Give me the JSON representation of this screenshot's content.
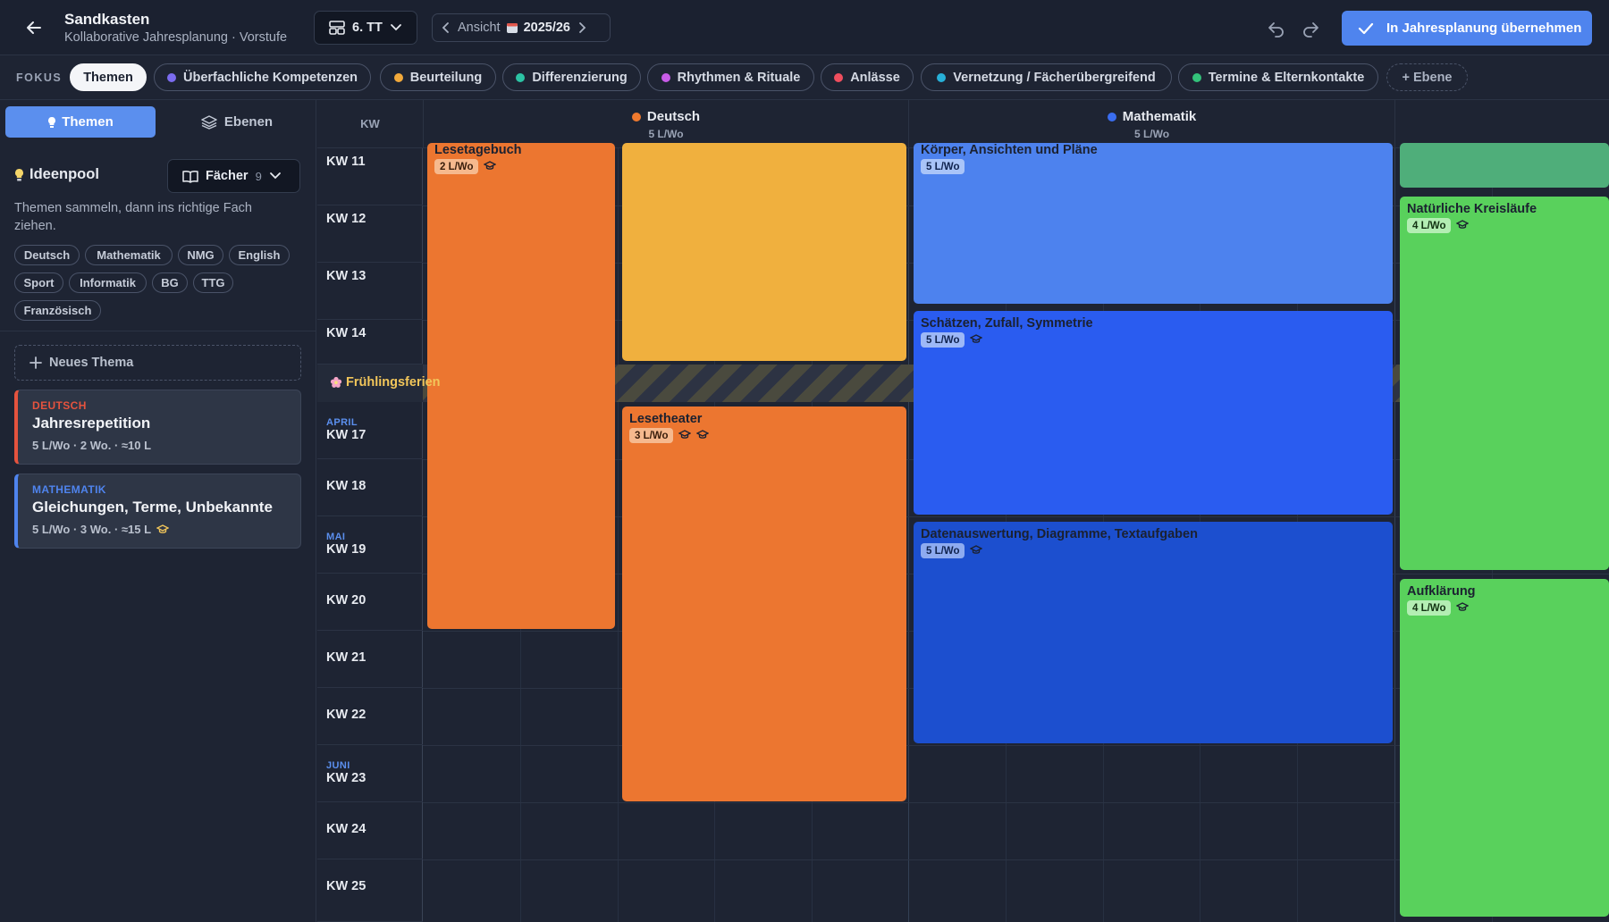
{
  "header": {
    "title": "Sandkasten",
    "subtitle": "Kollaborative Jahresplanung · Vorstufe",
    "class_select": "6. TT",
    "view_label": "Ansicht",
    "view_year": "2025/26",
    "apply_label": "In Jahresplanung übernehmen"
  },
  "focus": {
    "label": "FOKUS",
    "chips": [
      {
        "label": "Themen",
        "color": ""
      },
      {
        "label": "Überfachliche Kompetenzen",
        "color": "#7b6cf0"
      },
      {
        "label": "Beurteilung",
        "color": "#f2a93b"
      },
      {
        "label": "Differenzierung",
        "color": "#2cc3a4"
      },
      {
        "label": "Rhythmen & Rituale",
        "color": "#c85ce8"
      },
      {
        "label": "Anlässe",
        "color": "#ef4e5e"
      },
      {
        "label": "Vernetzung / Fächerübergreifend",
        "color": "#27b0d8"
      },
      {
        "label": "Termine & Elternkontakte",
        "color": "#33c27a"
      },
      {
        "label": "+ Ebene",
        "color": ""
      }
    ]
  },
  "sidebar": {
    "tab_themen": "Themen",
    "tab_ebenen": "Ebenen",
    "pool_title": "Ideenpool",
    "faecher_label": "Fächer",
    "faecher_count": "9",
    "description": "Themen sammeln, dann ins richtige Fach ziehen.",
    "tags": [
      "Deutsch",
      "Mathematik",
      "NMG",
      "English",
      "Sport",
      "Informatik",
      "BG",
      "TTG",
      "Französisch"
    ],
    "new_theme": "Neues Thema",
    "cards": [
      {
        "subject": "DEUTSCH",
        "title": "Jahresrepetition",
        "meta": "5 L/Wo · 2 Wo. · ≈10 L",
        "accent": "#e5533e"
      },
      {
        "subject": "MATHEMATIK",
        "title": "Gleichungen, Terme, Unbekannte",
        "meta": "5 L/Wo · 3 Wo. · ≈15 L",
        "accent": "#4f84ee"
      }
    ]
  },
  "grid": {
    "kw_header": "KW",
    "subjects": [
      {
        "name": "Deutsch",
        "lw": "5 L/Wo",
        "color": "#f07a2e"
      },
      {
        "name": "Mathematik",
        "lw": "5 L/Wo",
        "color": "#3a6df0"
      }
    ],
    "weeks": [
      {
        "month": "",
        "kw": "KW 11"
      },
      {
        "month": "",
        "kw": "KW 12"
      },
      {
        "month": "",
        "kw": "KW 13"
      },
      {
        "month": "",
        "kw": "KW 14"
      },
      {
        "month": "APRIL",
        "kw": "KW 17"
      },
      {
        "month": "",
        "kw": "KW 18"
      },
      {
        "month": "MAI",
        "kw": "KW 19"
      },
      {
        "month": "",
        "kw": "KW 20"
      },
      {
        "month": "",
        "kw": "KW 21"
      },
      {
        "month": "",
        "kw": "KW 22"
      },
      {
        "month": "JUNI",
        "kw": "KW 23"
      },
      {
        "month": "",
        "kw": "KW 24"
      },
      {
        "month": "",
        "kw": "KW 25"
      }
    ],
    "holiday": "Frühlingsferien",
    "blocks": [
      {
        "title": "Lesetagebuch",
        "badge": "2 L/Wo",
        "color": "#ec7630"
      },
      {
        "title": "",
        "badge": "",
        "color": "#f0b03e"
      },
      {
        "title": "Lesetheater",
        "badge": "3 L/Wo",
        "color": "#ec7630"
      },
      {
        "title": "Körper, Ansichten und Pläne",
        "badge": "5 L/Wo",
        "color": "#4d82ee"
      },
      {
        "title": "Schätzen, Zufall, Symmetrie",
        "badge": "5 L/Wo",
        "color": "#2a5cf0"
      },
      {
        "title": "Datenauswertung, Diagramme, Textaufgaben",
        "badge": "5 L/Wo",
        "color": "#1c4fcf"
      },
      {
        "title": "",
        "badge": "",
        "color": "#4fae7a"
      },
      {
        "title": "Natürliche Kreisläufe",
        "badge": "4 L/Wo",
        "color": "#59d15c"
      },
      {
        "title": "Aufklärung",
        "badge": "4 L/Wo",
        "color": "#59d15c"
      }
    ]
  }
}
